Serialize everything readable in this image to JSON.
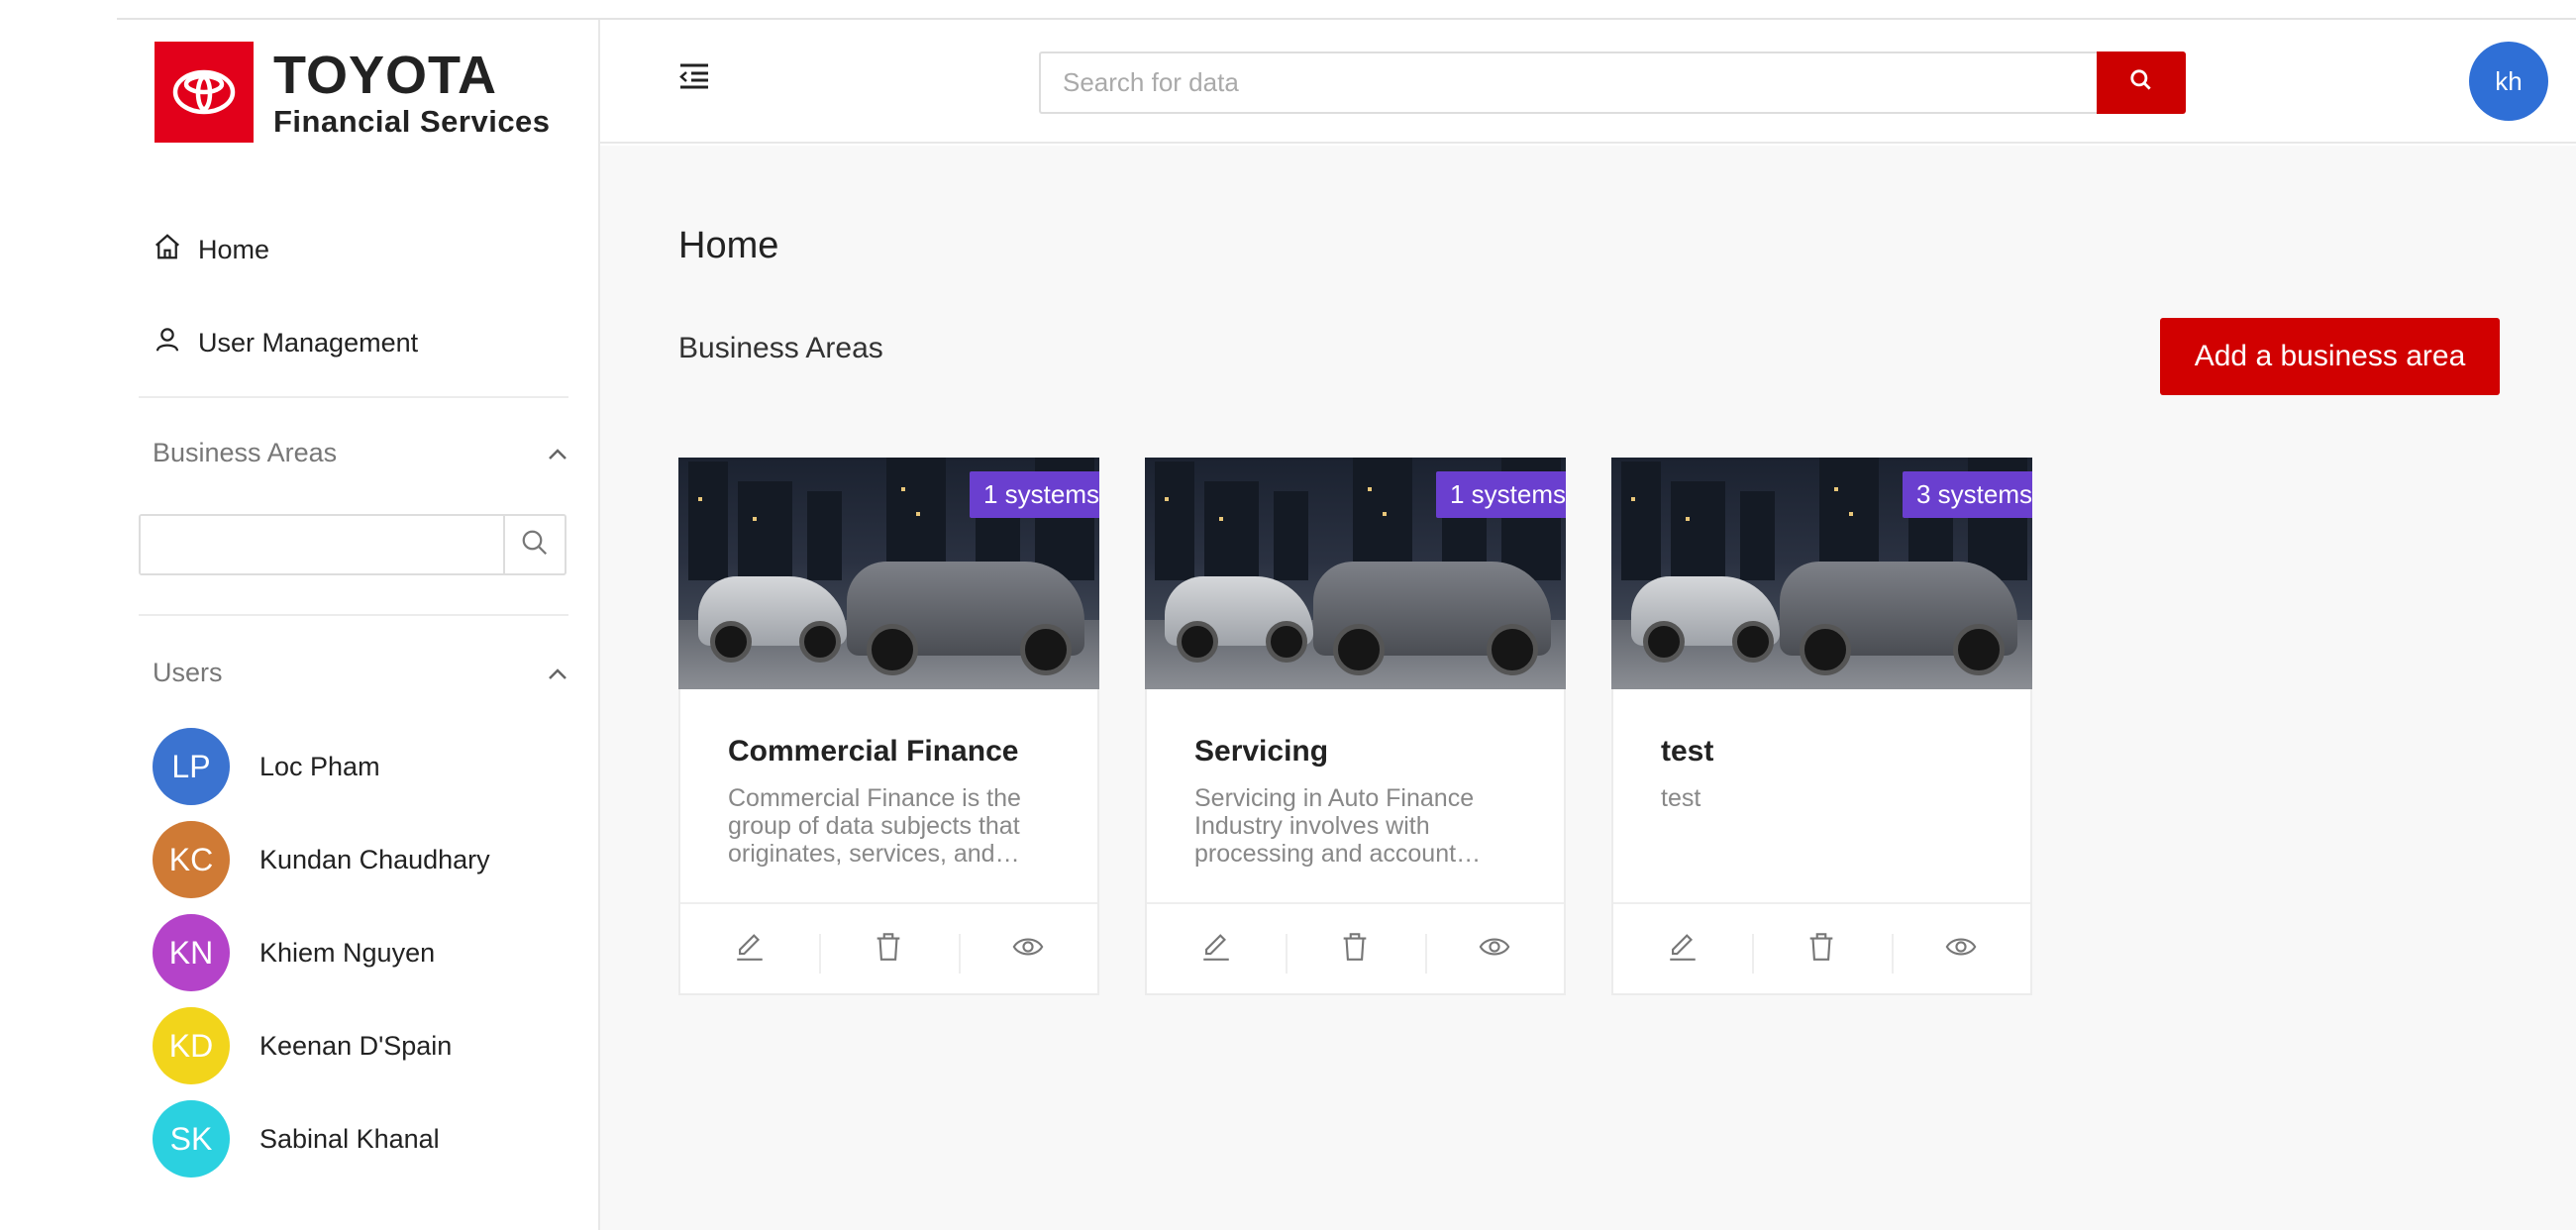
{
  "brand": {
    "title": "TOYOTA",
    "subtitle": "Financial Services",
    "color": "#e2001a"
  },
  "sidebar": {
    "nav": [
      {
        "label": "Home",
        "icon": "home-icon"
      },
      {
        "label": "User Management",
        "icon": "user-icon"
      }
    ],
    "business_areas": {
      "heading": "Business Areas",
      "search_value": "",
      "search_placeholder": ""
    },
    "users": {
      "heading": "Users",
      "items": [
        {
          "initials": "LP",
          "name": "Loc Pham",
          "color": "#3b73d0"
        },
        {
          "initials": "KC",
          "name": "Kundan Chaudhary",
          "color": "#cf7a35"
        },
        {
          "initials": "KN",
          "name": "Khiem Nguyen",
          "color": "#b443c9"
        },
        {
          "initials": "KD",
          "name": "Keenan D'Spain",
          "color": "#f2d51b"
        },
        {
          "initials": "SK",
          "name": "Sabinal Khanal",
          "color": "#2bd1e0"
        }
      ]
    }
  },
  "header": {
    "search_placeholder": "Search for data",
    "search_value": "",
    "user_initials": "kh",
    "accent": "#cc0000"
  },
  "main": {
    "title": "Home",
    "section_title": "Business Areas",
    "add_button": "Add a business area",
    "cards": [
      {
        "title": "Commercial Finance",
        "badge": "1 systems",
        "description": "Commercial Finance is the group of data subjects that originates, services, and…"
      },
      {
        "title": "Servicing",
        "badge": "1 systems",
        "description": "Servicing in Auto Finance Industry involves with processing and account…"
      },
      {
        "title": "test",
        "badge": "3 systems",
        "description": "test"
      }
    ],
    "badge_color": "#6a3fcf"
  }
}
